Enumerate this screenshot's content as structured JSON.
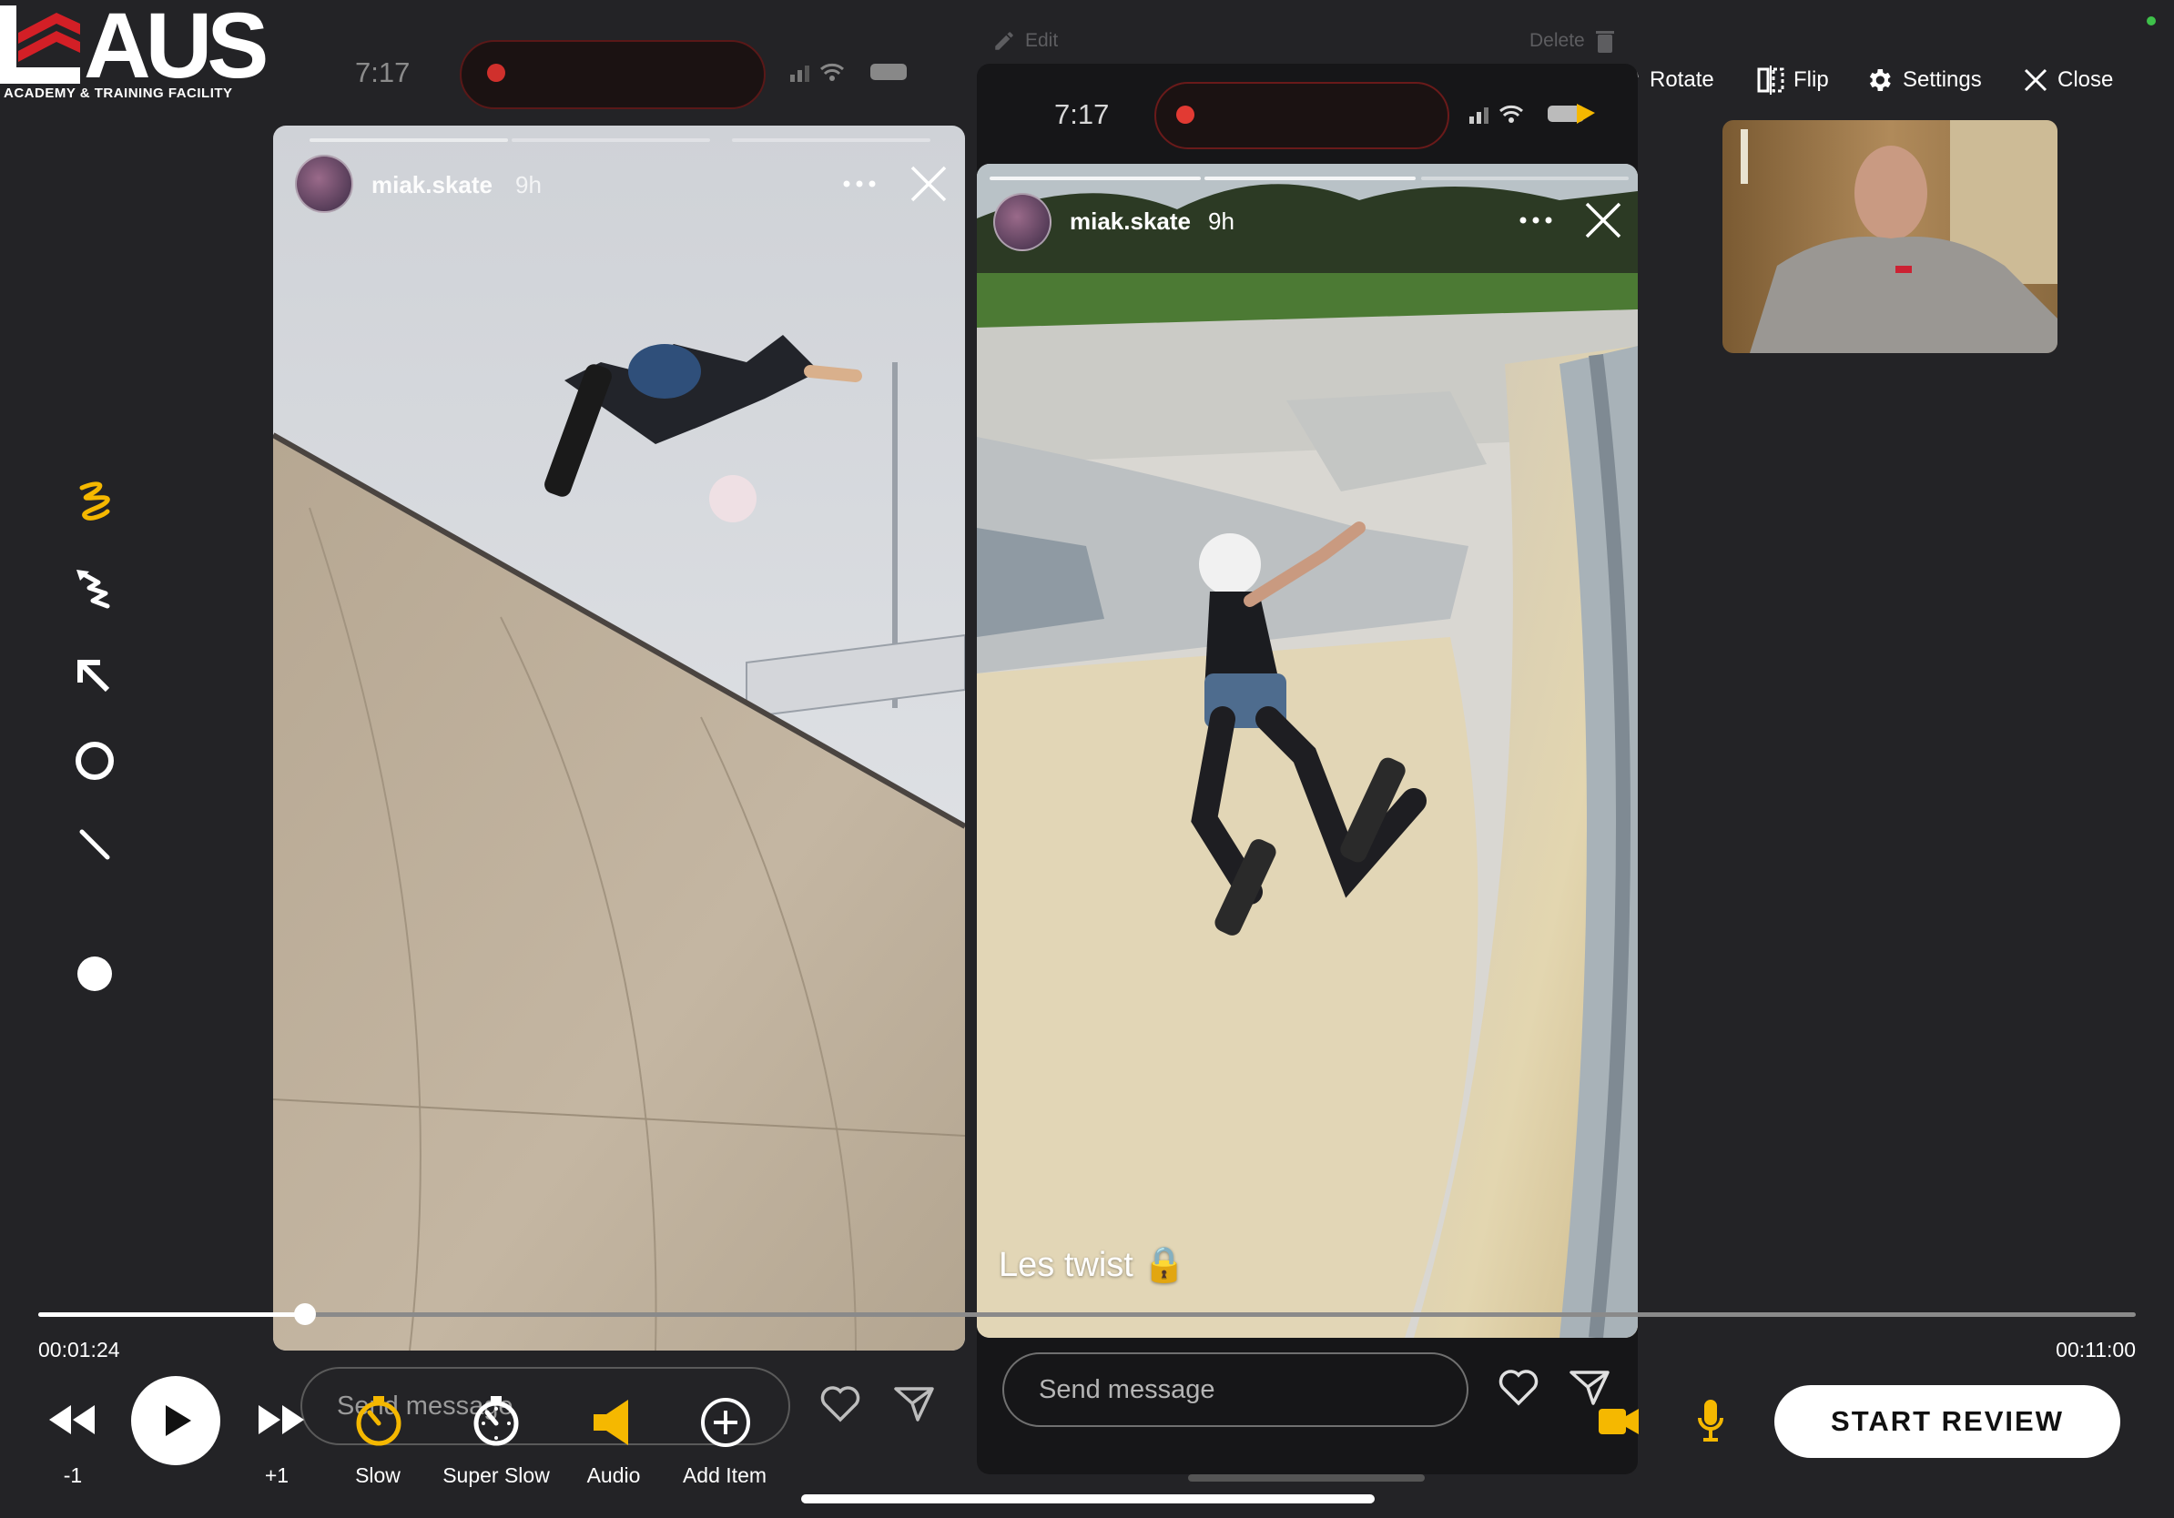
{
  "logo": {
    "word": "LAUS",
    "subtitle": "ACADEMY & TRAINING FACILITY"
  },
  "top_toolbar": {
    "edit_label": "Edit",
    "delete_label": "Delete",
    "rotate_label": "Rotate",
    "flip_label": "Flip",
    "settings_label": "Settings",
    "close_label": "Close"
  },
  "left_panel": {
    "status_time": "7:17",
    "username": "miak.skate",
    "posted_ago": "9h",
    "message_placeholder": "Send message"
  },
  "right_panel": {
    "status_time": "7:17",
    "username": "miak.skate",
    "posted_ago": "9h",
    "caption": "Les twist 🔒",
    "message_placeholder": "Send message"
  },
  "drawing_tools": [
    {
      "name": "freehand-icon",
      "active": true
    },
    {
      "name": "curved-arrow-icon",
      "active": false
    },
    {
      "name": "arrow-icon",
      "active": false
    },
    {
      "name": "circle-icon",
      "active": false
    },
    {
      "name": "line-icon",
      "active": false
    },
    {
      "name": "color-dot-icon",
      "active": false
    }
  ],
  "playback": {
    "current_time": "00:01:24",
    "total_time": "00:11:00",
    "progress_fraction": 0.127,
    "rewind_label": "-1",
    "forward_label": "+1",
    "slow_label": "Slow",
    "super_slow_label": "Super Slow",
    "audio_label": "Audio",
    "add_item_label": "Add Item"
  },
  "start_review_label": "START REVIEW",
  "colors": {
    "accent": "#f5b800",
    "background": "#232326",
    "brand_red": "#d31f26"
  }
}
